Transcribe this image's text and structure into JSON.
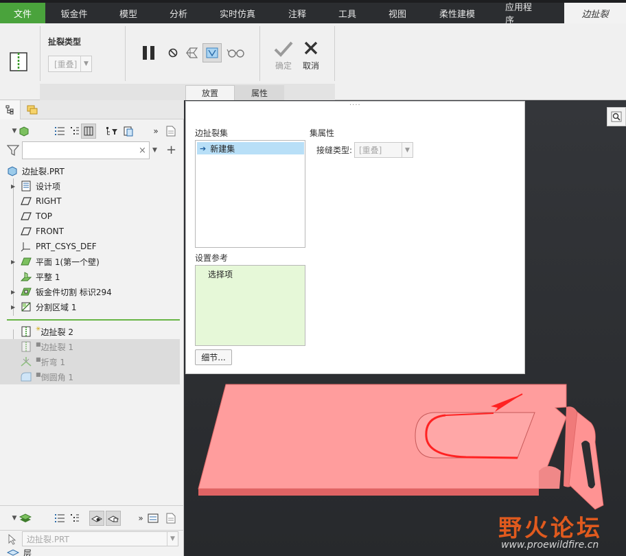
{
  "menu": {
    "file": "文件",
    "items": [
      "钣金件",
      "模型",
      "分析",
      "实时仿真",
      "注释",
      "工具",
      "视图",
      "柔性建模",
      "应用程序"
    ],
    "active": "边扯裂"
  },
  "ribbon": {
    "tear_type_label": "扯裂类型",
    "tear_type_value": "[重叠]",
    "ok_label": "确定",
    "cancel_label": "取消",
    "tab_placement": "放置",
    "tab_properties": "属性"
  },
  "tree": {
    "root": "边扯裂.PRT",
    "items": [
      {
        "label": "设计项",
        "icon": "design-items-icon"
      },
      {
        "label": "RIGHT",
        "icon": "datum-plane-icon"
      },
      {
        "label": "TOP",
        "icon": "datum-plane-icon"
      },
      {
        "label": "FRONT",
        "icon": "datum-plane-icon"
      },
      {
        "label": "PRT_CSYS_DEF",
        "icon": "csys-icon"
      },
      {
        "label": "平面 1(第一个壁)",
        "icon": "flat-wall-icon"
      },
      {
        "label": "平整 1",
        "icon": "flatten-icon"
      },
      {
        "label": "钣金件切割 标识294",
        "icon": "sheetmetal-cut-icon"
      },
      {
        "label": "分割区域 1",
        "icon": "split-area-icon"
      }
    ],
    "after_insert": [
      {
        "label": "边扯裂 2",
        "icon": "edge-rip-icon",
        "state": "active"
      },
      {
        "label": "边扯裂 1",
        "icon": "edge-rip-icon",
        "state": "suppressed"
      },
      {
        "label": "折弯 1",
        "icon": "bend-icon",
        "state": "suppressed"
      },
      {
        "label": "倒圆角 1",
        "icon": "round-icon",
        "state": "suppressed"
      }
    ],
    "layer_selector": "边扯裂.PRT",
    "bottom_label": "层"
  },
  "panel": {
    "set_list_label": "边扯裂集",
    "new_set": "新建集",
    "set_props_label": "集属性",
    "seam_type_label": "接缝类型:",
    "seam_type_value": "[重叠]",
    "refs_label": "设置参考",
    "select_items": "选择项",
    "details_button": "细节..."
  },
  "watermark": {
    "title": "野火论坛",
    "url": "www.proewildfire.cn"
  },
  "colors": {
    "file_tab": "#4aa33c",
    "part_fill": "#ff9a9a",
    "selection": "#b8dff7",
    "refs_box": "#e6f8d8",
    "annotation": "#ff2a2a"
  }
}
